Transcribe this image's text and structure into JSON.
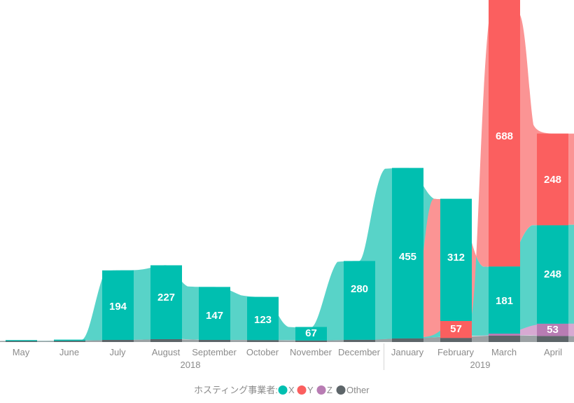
{
  "chart_data": {
    "type": "area",
    "title": "",
    "subtitle": "",
    "xlabel": "",
    "ylabel": "",
    "stacked": true,
    "smoothed": true,
    "grid": false,
    "legend_position": "bottom",
    "legend_title": "ホスティング事業者:",
    "categories": [
      "May",
      "June",
      "July",
      "August",
      "September",
      "October",
      "November",
      "December",
      "January",
      "February",
      "March",
      "April"
    ],
    "year_groups": [
      {
        "label": "2018",
        "months": [
          "May",
          "June",
          "July",
          "August",
          "September",
          "October",
          "November",
          "December"
        ]
      },
      {
        "label": "2019",
        "months": [
          "January",
          "February",
          "March",
          "April"
        ]
      }
    ],
    "series": [
      {
        "name": "X",
        "color": "#00bfb0",
        "area_color": "#58d3c8",
        "values": [
          4,
          6,
          194,
          227,
          147,
          123,
          67,
          280,
          455,
          312,
          181,
          248
        ]
      },
      {
        "name": "Y",
        "color": "#fb5f5f",
        "area_color": "#fb9494",
        "values": [
          0,
          0,
          0,
          0,
          0,
          0,
          0,
          0,
          0,
          57,
          688,
          248
        ]
      },
      {
        "name": "Z",
        "color": "#b87cb3",
        "area_color": "#d7a9d2",
        "values": [
          0,
          0,
          0,
          0,
          0,
          0,
          0,
          0,
          0,
          0,
          6,
          53
        ]
      },
      {
        "name": "Other",
        "color": "#5d6569",
        "area_color": "#9ba1a4",
        "values": [
          3,
          3,
          5,
          6,
          4,
          4,
          3,
          5,
          8,
          10,
          12,
          10
        ]
      }
    ],
    "visible_labels": [
      {
        "series": "X",
        "category": "July",
        "value": 194
      },
      {
        "series": "X",
        "category": "August",
        "value": 227
      },
      {
        "series": "X",
        "category": "September",
        "value": 147
      },
      {
        "series": "X",
        "category": "October",
        "value": 123
      },
      {
        "series": "X",
        "category": "November",
        "value": 67
      },
      {
        "series": "X",
        "category": "December",
        "value": 280
      },
      {
        "series": "X",
        "category": "January",
        "value": 455
      },
      {
        "series": "X",
        "category": "February",
        "value": 312
      },
      {
        "series": "X",
        "category": "March",
        "value": 181
      },
      {
        "series": "X",
        "category": "April",
        "value": 248
      },
      {
        "series": "Y",
        "category": "February",
        "value": 57
      },
      {
        "series": "Y",
        "category": "March",
        "value": 688
      },
      {
        "series": "Y",
        "category": "April",
        "value": 248
      },
      {
        "series": "Z",
        "category": "April",
        "value": 53
      }
    ],
    "ylim": [
      0,
      900
    ],
    "note": "March Y value peak is clipped at the top edge of the plot area"
  },
  "legend": {
    "title": "ホスティング事業者:",
    "items": [
      {
        "label": "X",
        "color": "#00bfb0"
      },
      {
        "label": "Y",
        "color": "#fb5f5f"
      },
      {
        "label": "Z",
        "color": "#b87cb3"
      },
      {
        "label": "Other",
        "color": "#5d6569"
      }
    ]
  },
  "axis": {
    "months": [
      "May",
      "June",
      "July",
      "August",
      "September",
      "October",
      "November",
      "December",
      "January",
      "February",
      "March",
      "April"
    ],
    "years": [
      "2018",
      "2019"
    ]
  },
  "labels": {
    "july_x": "194",
    "august_x": "227",
    "september_x": "147",
    "october_x": "123",
    "november_x": "67",
    "december_x": "280",
    "january_x": "455",
    "february_x": "312",
    "february_y": "57",
    "march_x": "181",
    "march_y": "688",
    "april_x": "248",
    "april_y": "248",
    "april_z": "53"
  }
}
